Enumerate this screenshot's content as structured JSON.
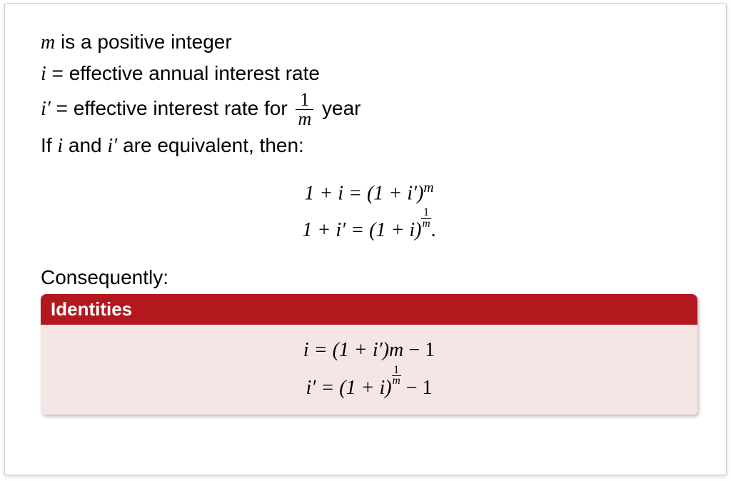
{
  "line1_m": "m",
  "line1_text": " is a positive integer",
  "line2_i": "i",
  "line2_text": " = effective annual interest rate",
  "line3_iprime": "i′",
  "line3_text1": " = effective interest rate for ",
  "frac_num": "1",
  "frac_den": "m",
  "line3_text2": " year",
  "line4_pre": "If ",
  "line4_i": "i",
  "line4_mid": " and ",
  "line4_iprime": "i′",
  "line4_post": " are equivalent, then:",
  "eq1": "1 + i = (1 + i′)",
  "eq1_exp": "m",
  "eq2": "1 + i′ = (1 + i)",
  "eq2_tfrac_n": "1",
  "eq2_tfrac_d": "m",
  "eq2_end": ".",
  "consequently": "Consequently:",
  "box_title": "Identities",
  "id1_lhs": "i = (1 + i′)",
  "id1_exp": "m",
  "id1_rhs": " − 1",
  "id2_lhs": "i′ = (1 + i)",
  "id2_tfrac_n": "1",
  "id2_tfrac_d": "m",
  "id2_rhs": " − 1"
}
